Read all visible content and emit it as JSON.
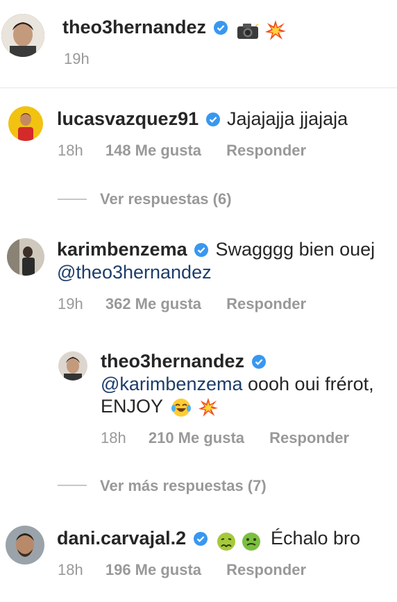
{
  "post": {
    "username": "theo3hernandez",
    "time": "19h",
    "caption_icons": [
      "camera-with-flash-icon",
      "collision-icon"
    ]
  },
  "comments": [
    {
      "username": "lucasvazquez91",
      "text": "Jajajajja jjajaja",
      "time": "18h",
      "likes": "148 Me gusta",
      "reply": "Responder",
      "view_replies": "Ver respuestas (6)"
    },
    {
      "username": "karimbenzema",
      "text": "Swagggg bien ouej",
      "mention": "@theo3hernandez",
      "time": "19h",
      "likes": "362 Me gusta",
      "reply": "Responder",
      "view_replies": "Ver más respuestas (7)"
    },
    {
      "username": "dani.carvajal.2",
      "text": "Échalo bro",
      "time": "18h",
      "likes": "196 Me gusta",
      "reply": "Responder",
      "icons": [
        "nauseated-face-icon",
        "sick-face-icon"
      ]
    }
  ],
  "reply": {
    "username": "theo3hernandez",
    "mention": "@karimbenzema",
    "text": " oooh oui frérot,",
    "text2": "ENJOY",
    "time": "18h",
    "likes": "210 Me gusta",
    "reply": "Responder",
    "icons": [
      "tears-of-joy-icon",
      "collision-icon"
    ]
  },
  "colors": {
    "verified": "#3897f0",
    "meta": "#999999",
    "mention": "#1d3d6b"
  }
}
